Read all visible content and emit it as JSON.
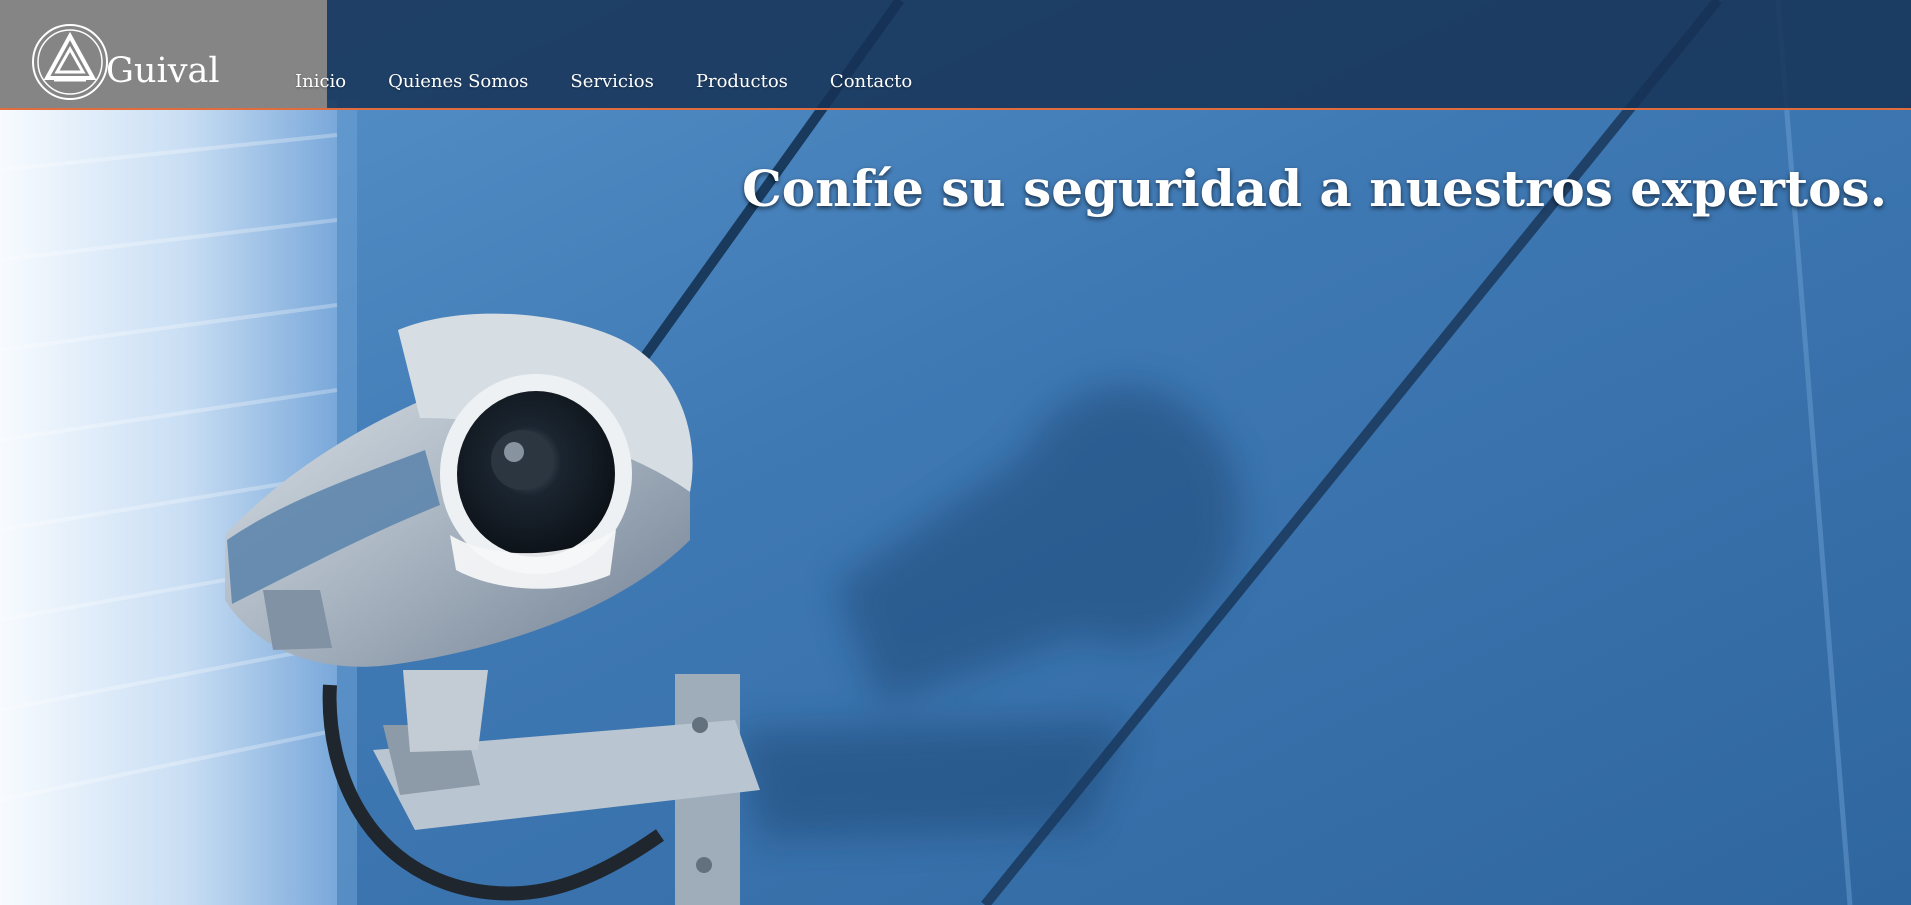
{
  "brand": {
    "name": "Guival",
    "logo_icon": "guival-triangle-logo-icon"
  },
  "nav": {
    "items": [
      {
        "label": "Inicio"
      },
      {
        "label": "Quienes Somos"
      },
      {
        "label": "Servicios"
      },
      {
        "label": "Productos"
      },
      {
        "label": "Contacto"
      }
    ]
  },
  "hero": {
    "headline": "Confíe su seguridad a nuestros expertos.",
    "image": "security-camera-on-glass-wall"
  },
  "colors": {
    "header_background": "#17365e",
    "logo_background": "#858585",
    "accent": "#e16c3d",
    "hero_blue": "#3f79b4"
  }
}
